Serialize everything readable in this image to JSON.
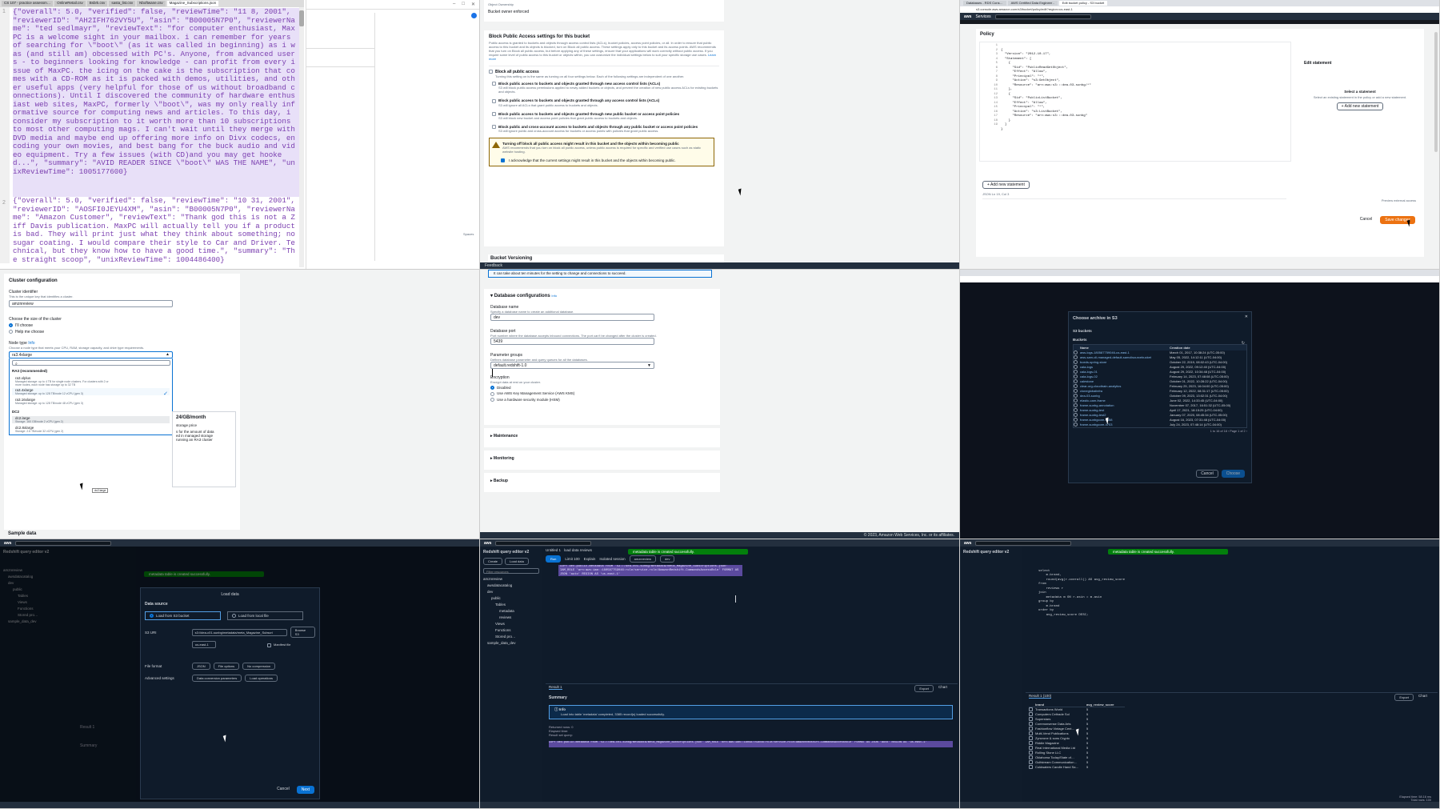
{
  "p1": {
    "tabs": [
      "CS 107 - practice assessm…",
      "OnlineRetail.csv",
      "Bsbrk.csv",
      "sasta_list.csv",
      "Nboftwane.csv",
      "Magazine_Subscriptions.json"
    ],
    "line1": "1",
    "line2": "2",
    "json1": "{\"overall\": 5.0, \"verified\": false, \"reviewTime\": \"11 8, 2001\", \"reviewerID\": \"AH2IFH762VY5U\", \"asin\": \"B00005N7P0\", \"reviewerName\": \"ted sedlmayr\", \"reviewText\": \"for computer enthusiast, MaxPC is a welcome sight in your mailbox. i can remember for years of searching for \\\"boot\\\" (as it was called in beginning) as i was (and still am) obcessed with PC's. Anyone, from advanced users - to beginners looking for knowledge - can profit from every issue of MaxPC. the icing on the cake is the subscription that comes with a CD-ROM as it is packed with demos, utilities, and other useful apps (very helpful for those of us without broadband connections). Until I discovered the community of hardware enthusiast web sites, MaxPC, formerly \\\"boot\\\", was my only really informative source for computing news and articles. To this day, i consider my subscription to it worth more than 10 subscriptions to most other computing mags. I can't wait until they merge with DVD media and maybe end up offering more info on Divx codecs, encoding your own movies, and best bang for the buck audio and video equipment. Try a few issues (with CD)and you may get hooked...\", \"summary\": \"AVID READER SINCE \\\"boot\\\" WAS THE NAME\", \"unixReviewTime\": 1005177600}",
    "json2": "{\"overall\": 5.0, \"verified\": false, \"reviewTime\": \"10 31, 2001\", \"reviewerID\": \"AOSFI0JEYU4XM\", \"asin\": \"B00005N7P0\", \"reviewerName\": \"Amazon Customer\", \"reviewText\": \"Thank god this is not a Ziff Davis publication. MaxPC will actually tell you if a product is bad. They will print just what they think about something; no sugar coating. I would compare their style to Car and Driver. Technical, but they know how to have a good time.\", \"summary\": \"The straight scoop\", \"unixReviewTime\": 1004486400}",
    "side_label": "Spaces"
  },
  "p2": {
    "object_ownership": "Object Ownership",
    "acl_disabled": "Bucket owner enforced",
    "bpa_title": "Block Public Access settings for this bucket",
    "bpa_desc": "Public access is granted to buckets and objects through access control lists (ACLs), bucket policies, access point policies, or all. In order to ensure that public access to this bucket and its objects is blocked, turn on Block all public access. These settings apply only to this bucket and its access points. AWS recommends that you turn on Block all public access, but before applying any of these settings, ensure that your applications will work correctly without public access. If you require some level of public access to this bucket or objects within, you can customize the individual settings below to suit your specific storage use cases.",
    "learn_more": "Learn more",
    "opt_all": "Block all public access",
    "opt_all_desc": "Turning this setting on is the same as turning on all four settings below. Each of the following settings are independent of one another.",
    "opts": [
      {
        "t": "Block public access to buckets and objects granted through new access control lists (ACLs)",
        "d": "S3 will block public access permissions applied to newly added buckets or objects, and prevent the creation of new public access ACLs for existing buckets and objects."
      },
      {
        "t": "Block public access to buckets and objects granted through any access control lists (ACLs)",
        "d": "S3 will ignore all ACLs that grant public access to buckets and objects."
      },
      {
        "t": "Block public access to buckets and objects granted through new public bucket or access point policies",
        "d": "S3 will block new bucket and access point policies that grant public access to buckets and objects."
      },
      {
        "t": "Block public and cross-account access to buckets and objects through any public bucket or access point policies",
        "d": "S3 will ignore public and cross-account access for buckets or access points with policies that grant public access."
      }
    ],
    "warn_title": "Turning off block all public access might result in this bucket and the objects within becoming public",
    "warn_desc": "AWS recommends that you turn on block all public access, unless public access is required for specific and verified use cases such as static website hosting.",
    "ack": "I acknowledge that the current settings might result in this bucket and the objects within becoming public.",
    "versioning": "Bucket Versioning",
    "feedback": "Feedback"
  },
  "p3": {
    "tabs": [
      "Databases - RDS Cons…",
      "AWS Certified Data Engineer -",
      "Edit bucket policy - S3 bucket",
      ""
    ],
    "url": "s3.console.aws.amazon.com/s3/bucket/policy/edit?region=us-east-1",
    "services": "Services",
    "search": "Search",
    "policy": "Policy",
    "code": [
      "{",
      "  \"Version\": \"2012-10-17\",",
      "  \"Statement\": [",
      "    {",
      "      \"Sid\": \"PublicReadGetObject\",",
      "      \"Effect\": \"Allow\",",
      "      \"Principal\": \"*\",",
      "      \"Action\": \"s3:GetObject\",",
      "      \"Resource\": \"arn:aws:s3:::dea-03-sunbg/*\"",
      "    },",
      "    {",
      "      \"Sid\": \"PublicListBucket\",",
      "      \"Effect\": \"Allow\",",
      "      \"Principal\": \"*\",",
      "      \"Action\": \"s3:ListBucket\",",
      "      \"Resource\": \"arn:aws:s3:::dea-03-sunbg\"",
      "    }",
      "  ]",
      "}"
    ],
    "edit_statement": "Edit statement",
    "select_statement": "Select a statement",
    "select_desc": "Select an existing statement in the policy or add a new statement.",
    "add_new": "+ Add new statement",
    "add_new_btn": "+ Add new statement",
    "json_meta": "JSON  Ln 19, Col 3",
    "cancel": "Cancel",
    "save": "Save changes",
    "preview": "Preview external access"
  },
  "p4": {
    "title": "Cluster configuration",
    "id_label": "Cluster identifier",
    "id_desc": "This is the unique key that identifies a cluster.",
    "id_value": "amznreview",
    "size_label": "Choose the size of the cluster",
    "opt_choose": "I'll choose",
    "opt_help": "Help me choose",
    "node_label": "Node type",
    "info": "Info",
    "node_desc": "Choose a node type that meets your CPU, RAM, storage capacity, and drive type requirements.",
    "node_value": "ra3.4xlarge",
    "group_ra3": "RA3 (recommended)",
    "nodes": [
      {
        "n": "ra3.xlplus",
        "d": "Managed storage: up to 4 TB for single node clusters. For clusters with 2 or more nodes, each node has storage up to 32 TB"
      },
      {
        "n": "ra3.4xlarge",
        "d": "Managed storage: up to 128 TB/node  12 vCPU (gen 3)"
      },
      {
        "n": "ra3.16xlarge",
        "d": "Managed storage: up to 128 TB/node  48 vCPU (gen 3)"
      }
    ],
    "group_dc2": "DC2",
    "dc2": [
      {
        "n": "dc2.large",
        "d": "Storage: 160 GB/node  2 vCPU (gen 2)"
      },
      {
        "n": "dc2.8xlarge",
        "d": "Storage: 2.6 TB/node  32 vCPU (gen 2)"
      }
    ],
    "tooltip": "dc2.large",
    "price": "24/GB/month",
    "price_lines": [
      "storage price",
      "s for the amount of data",
      "ed in managed storage",
      "running an RA3 cluster"
    ],
    "sample": "Sample data"
  },
  "p5": {
    "banner": "It can take about ten minutes for the setting to change and connections to succeed.",
    "title": "Database configurations",
    "info": "Info",
    "db_name_label": "Database name",
    "db_name_desc": "Specify a database name to create an additional database.",
    "db_name": "dev",
    "db_port_label": "Database port",
    "db_port_desc": "Port number where the database accepts inbound connections. The port can't be changed after the cluster is created.",
    "db_port": "5439",
    "pg_label": "Parameter groups",
    "pg_desc": "Defines database parameter and query queues for all the databases.",
    "pg_value": "default.redshift-1.0",
    "enc_label": "Encryption",
    "enc_desc": "Encrypt data at rest on your cluster.",
    "enc_opts": [
      "Disabled",
      "Use AWS Key Management Service (AWS KMS)",
      "Use a hardware security module (HSM)"
    ],
    "sections": [
      "Maintenance",
      "Monitoring",
      "Backup"
    ],
    "footer": "© 2023, Amazon Web Services, Inc. or its affiliates."
  },
  "p6": {
    "title": "Choose archive in S3",
    "sub": "S3 buckets",
    "buckets_label": "Buckets",
    "col_name": "Name",
    "col_date": "Creation date",
    "rows": [
      [
        "aws-logs-180587759046-us-east-1",
        "March 01, 2017, 10:38:24 (UTC-05:00)"
      ],
      [
        "aws-sam-cli-managed-default-samclisourcebucket",
        "May 05, 2022, 14:12:11 (UTC-04:00)"
      ],
      [
        "boeds-spring-store",
        "October 22, 2019, 08:02:43 (UTC-04:00)"
      ],
      [
        "cala-logs",
        "August 29, 2022, 09:12:40 (UTC-04:00)"
      ],
      [
        "cala-logs-01",
        "August 29, 2022, 10:34:48 (UTC-04:00)"
      ],
      [
        "cala-logs-02",
        "February 14, 2023, 07:48:08 (UTC-05:00)"
      ],
      [
        "calestone",
        "October 01, 2022, 10:28:22 (UTC-04:00)"
      ],
      [
        "clear-org-cloudtrain-analytics",
        "February 25, 2023, 16:04:00 (UTC-05:00)"
      ],
      [
        "cloneglobalinfra",
        "February 12, 2022, 08:31:17 (UTC-05:00)"
      ],
      [
        "dea-03-sunbg",
        "October 09, 2023, 13:02:31 (UTC-04:00)"
      ],
      [
        "elastic-cam-frame",
        "June 02, 2022, 14:33:45 (UTC-04:00)"
      ],
      [
        "frame-sunbg-annotation",
        "November 07, 2017, 16:51:32 (UTC-05:00)"
      ],
      [
        "frame-sunbg-test",
        "April 17, 2021, 18:15:25 (UTC-04:00)"
      ],
      [
        "frame-sunbg-test2",
        "January 07, 2020, 08:45:34 (UTC-05:00)"
      ],
      [
        "frame-sunbgcore-4458",
        "August 16, 2023, 07:31:48 (UTC-04:00)"
      ],
      [
        "frame-sunbgcore-4703",
        "July 24, 2023, 07:48:14 (UTC-04:00)"
      ]
    ],
    "pager": "1 to 16 of 18",
    "page": "Page 1 of 2",
    "cancel": "Cancel",
    "choose": "Choose"
  },
  "p7": {
    "title": "Redshift query editor v2",
    "toast": "metadata table is created successfully.",
    "modal_title": "Load data",
    "data_source": "Data source",
    "opt_s3": "Load from S3 bucket",
    "opt_local": "Load from local file",
    "s3uri_label": "S3 URI",
    "s3uri": "s3://dea-c01-sunbg/metadata/meta_Magazine_Subscri",
    "browse": "Browse S3",
    "region": "us-east-1",
    "manifest": "Manifest file",
    "fileformat_label": "File format",
    "fmt": "JSON",
    "fileopts": "File options",
    "compression": "No compression",
    "adv_label": "Advanced settings",
    "dcp": "Data conversion parameters",
    "loadops": "Load operations",
    "cancel": "Cancel",
    "next": "Next",
    "tree": [
      "amznreview",
      "awsdatacatalog",
      "dev",
      "public",
      "Tables",
      "Views",
      "Functions",
      "Stored pro…",
      "sample_data_dev"
    ],
    "result": "Result 1",
    "summary": "Summary"
  },
  "p8": {
    "title": "Redshift query editor v2",
    "toast": "metadata table is created successfully.",
    "tab1": "Untitled 1",
    "tab2": "load data reviews",
    "create": "Create",
    "loaddata": "Load data",
    "run": "Run",
    "limit": "Limit 100",
    "explain": "Explain",
    "isolated": "Isolated session",
    "conn": "amznreview",
    "db": "dev",
    "filter": "Filter resources",
    "tree": [
      "amznreview",
      "awsdatacatalog",
      "dev",
      "public",
      "Tables",
      "metadata",
      "reviews",
      "Views",
      "Functions",
      "Stored pro…",
      "sample_data_dev"
    ],
    "sql": "COPY dev.public.metadata FROM 's3://dea-c01-sunbg/metadata/meta_Magazine_Subscriptions.json' IAM_ROLE 'arn:aws:iam::180587759046:role/service-role/AmazonRedshift-CommandsAccessRole' FORMAT AS JSON 'auto' REGION AS 'us-east-1'",
    "result": "Result 1",
    "summary": "Summary",
    "info": "Info",
    "info_msg": "Load into table 'metadata' completed, 3385 record(s) loaded successfully.",
    "export": "Export",
    "chart": "Chart",
    "returned": "Returned rows: 0",
    "elapsed": "Elapsed time:",
    "result_set": "Result set query:"
  },
  "p9": {
    "title": "Redshift query editor v2",
    "toast": "metadata table is created successfully.",
    "sql": [
      "select",
      "    m.brand,",
      "    round(avg(r.overall)) AS avg_review_score",
      "from",
      "    reviews r",
      "join",
      "    metadata m ON r.asin = m.asin",
      "group by",
      "    m.brand",
      "order by",
      "    avg_review_score DESC;"
    ],
    "result": "Result 1 (100)",
    "col1": "brand",
    "col2": "avg_review_score",
    "rows": [
      [
        "Transactions World",
        "5"
      ],
      [
        "Computers Celtrade Sol",
        "5"
      ],
      [
        "Superstars",
        "5"
      ],
      [
        "Commonsense Data Arts",
        "5"
      ],
      [
        "Fashionflow Vintage Cent…",
        "5"
      ],
      [
        "Multi-Vend Publications",
        "5"
      ],
      [
        "Zyncrone & sons Crypto",
        "5"
      ],
      [
        "Riddle Magazine",
        "5"
      ],
      [
        "Real International Media Ltd",
        "5"
      ],
      [
        "Rolling Stone LLC",
        "5"
      ],
      [
        "Oklahoma Today/State of…",
        "5"
      ],
      [
        "Gulfstream Communication…",
        "5"
      ],
      [
        "Coldwaters Candle Hand Sa…",
        "5"
      ]
    ],
    "elapsed": "Elapsed time: 58.16 ms",
    "total": "Total rows: 100",
    "export": "Export",
    "chart": "Chart"
  }
}
